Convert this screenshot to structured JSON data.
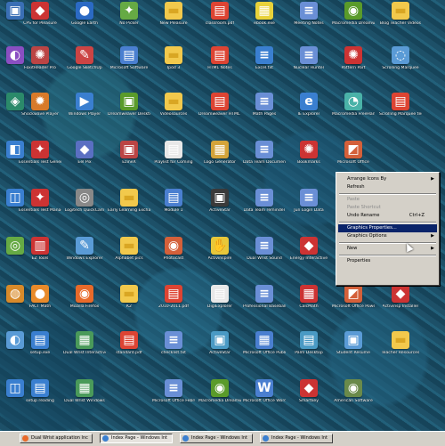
{
  "desktop": {
    "icons": [
      {
        "label": "",
        "icon": "app-icon",
        "color": "#3a6fb5",
        "glyph": "▣",
        "col": 0,
        "row": 0
      },
      {
        "label": "CPS for Pleasure",
        "icon": "app-icon",
        "color": "#c33",
        "glyph": "◆",
        "col": 1,
        "row": 0
      },
      {
        "label": "Google Earth",
        "icon": "globe-icon",
        "color": "#2b6ac4",
        "glyph": "●",
        "col": 2,
        "row": 0
      },
      {
        "label": "No Picker",
        "icon": "app-icon",
        "color": "#6a4",
        "glyph": "✦",
        "col": 3,
        "row": 0
      },
      {
        "label": "New Pleasure",
        "icon": "folder-icon",
        "color": "#f2c94c",
        "glyph": "▬",
        "col": 4,
        "row": 0
      },
      {
        "label": "classroom.pdf",
        "icon": "pdf-icon",
        "color": "#d43",
        "glyph": "▤",
        "col": 5,
        "row": 0
      },
      {
        "label": "ebook.exe",
        "icon": "app-icon",
        "color": "#e8d23a",
        "glyph": "▦",
        "col": 6,
        "row": 0
      },
      {
        "label": "Meeting Notes",
        "icon": "document-icon",
        "color": "#6a8fd6",
        "glyph": "≡",
        "col": 7,
        "row": 0
      },
      {
        "label": "Macromedia Dreamweaver",
        "icon": "dreamweaver-icon",
        "color": "#5a9b2a",
        "glyph": "◉",
        "col": 8,
        "row": 0
      },
      {
        "label": "Blog Teacher Videos",
        "icon": "folder-icon",
        "color": "#f2c94c",
        "glyph": "▬",
        "col": 9,
        "row": 0
      },
      {
        "label": "",
        "icon": "app-icon",
        "color": "#8a4fc2",
        "glyph": "◐",
        "col": 0,
        "row": 1
      },
      {
        "label": "FoxitReader Pro",
        "icon": "app-icon",
        "color": "#b44",
        "glyph": "✺",
        "col": 1,
        "row": 1
      },
      {
        "label": "Google SketchUp",
        "icon": "app-icon",
        "color": "#c44",
        "glyph": "✎",
        "col": 2,
        "row": 1
      },
      {
        "label": "Microsoft Software",
        "icon": "document-icon",
        "color": "#4a7fd0",
        "glyph": "▤",
        "col": 3,
        "row": 1
      },
      {
        "label": "Ipod 3",
        "icon": "folder-icon",
        "color": "#f2c94c",
        "glyph": "▬",
        "col": 4,
        "row": 1
      },
      {
        "label": "HTML Notes",
        "icon": "pdf-icon",
        "color": "#d43",
        "glyph": "▤",
        "col": 5,
        "row": 1
      },
      {
        "label": "Excel.txt",
        "icon": "document-icon",
        "color": "#3a7fd0",
        "glyph": "≡",
        "col": 6,
        "row": 1
      },
      {
        "label": "Nuclear Hunter",
        "icon": "document-icon",
        "color": "#6a8fd6",
        "glyph": "≡",
        "col": 7,
        "row": 1
      },
      {
        "label": "Pattern Part",
        "icon": "app-icon",
        "color": "#c33",
        "glyph": "✺",
        "col": 8,
        "row": 1
      },
      {
        "label": "Scrolling Marquee",
        "icon": "app-icon",
        "color": "#5a9bd6",
        "glyph": "◌",
        "col": 9,
        "row": 1
      },
      {
        "label": "",
        "icon": "app-icon",
        "color": "#2b8a6a",
        "glyph": "◈",
        "col": 0,
        "row": 2
      },
      {
        "label": "Shockwave Player",
        "icon": "app-icon",
        "color": "#d87a2a",
        "glyph": "✹",
        "col": 1,
        "row": 2
      },
      {
        "label": "Windows Player",
        "icon": "app-icon",
        "color": "#3a7fd0",
        "glyph": "▶",
        "col": 2,
        "row": 2
      },
      {
        "label": "Dreamweaver Desktop",
        "icon": "app-icon",
        "color": "#5a9b2a",
        "glyph": "▣",
        "col": 3,
        "row": 2
      },
      {
        "label": "Videosources",
        "icon": "folder-icon",
        "color": "#f2c94c",
        "glyph": "▬",
        "col": 4,
        "row": 2
      },
      {
        "label": "Dreamweaver HTML Code",
        "icon": "pdf-icon",
        "color": "#d43",
        "glyph": "▤",
        "col": 5,
        "row": 2
      },
      {
        "label": "Math Pages",
        "icon": "document-icon",
        "color": "#6a8fd6",
        "glyph": "≡",
        "col": 6,
        "row": 2
      },
      {
        "label": "IE Explorer",
        "icon": "ie-icon",
        "color": "#3a7fd0",
        "glyph": "e",
        "col": 7,
        "row": 2
      },
      {
        "label": "Macromedia FreeHand",
        "icon": "app-icon",
        "color": "#4ab2a8",
        "glyph": "◔",
        "col": 8,
        "row": 2
      },
      {
        "label": "Scrolling Marquee test",
        "icon": "pdf-icon",
        "color": "#d43",
        "glyph": "▤",
        "col": 9,
        "row": 2
      },
      {
        "label": "",
        "icon": "app-icon",
        "color": "#3a7fd0",
        "glyph": "◧",
        "col": 0,
        "row": 3
      },
      {
        "label": "Essentials Test Generator",
        "icon": "app-icon",
        "color": "#c33",
        "glyph": "✦",
        "col": 1,
        "row": 3
      },
      {
        "label": "Eel Pix",
        "icon": "app-icon",
        "color": "#5a6fc2",
        "glyph": "◆",
        "col": 2,
        "row": 3
      },
      {
        "label": "EzineX",
        "icon": "app-icon",
        "color": "#b44",
        "glyph": "▣",
        "col": 3,
        "row": 3
      },
      {
        "label": "Playlist for Coming",
        "icon": "document-icon",
        "color": "#e8e8e8",
        "glyph": "▤",
        "col": 4,
        "row": 3
      },
      {
        "label": "Logo Generator",
        "icon": "app-icon",
        "color": "#d4a43a",
        "glyph": "▦",
        "col": 5,
        "row": 3
      },
      {
        "label": "Data Team Documents",
        "icon": "document-icon",
        "color": "#6a8fd6",
        "glyph": "≡",
        "col": 6,
        "row": 3
      },
      {
        "label": "Bookmarks",
        "icon": "app-icon",
        "color": "#c33",
        "glyph": "✺",
        "col": 7,
        "row": 3
      },
      {
        "label": "Microsoft Office",
        "icon": "app-icon",
        "color": "#d4603a",
        "glyph": "◩",
        "col": 8,
        "row": 3
      },
      {
        "label": "",
        "icon": "",
        "color": "",
        "glyph": "",
        "col": 9,
        "row": 3
      },
      {
        "label": "",
        "icon": "app-icon",
        "color": "#3a7fd0",
        "glyph": "◫",
        "col": 0,
        "row": 4
      },
      {
        "label": "Essentials Test Manager",
        "icon": "app-icon",
        "color": "#c33",
        "glyph": "✦",
        "col": 1,
        "row": 4
      },
      {
        "label": "Logitech QuickCam",
        "icon": "camera-icon",
        "color": "#888",
        "glyph": "◎",
        "col": 2,
        "row": 4
      },
      {
        "label": "Early Learning Exchange",
        "icon": "folder-icon",
        "color": "#f2c94c",
        "glyph": "▬",
        "col": 3,
        "row": 4
      },
      {
        "label": "Module 1",
        "icon": "app-icon",
        "color": "#4a7fd0",
        "glyph": "▤",
        "col": 4,
        "row": 4
      },
      {
        "label": "ActiveStar",
        "icon": "app-icon",
        "color": "#3a3a3a",
        "glyph": "▣",
        "col": 5,
        "row": 4
      },
      {
        "label": "Data Team reminder",
        "icon": "document-icon",
        "color": "#6a8fd6",
        "glyph": "≡",
        "col": 6,
        "row": 4
      },
      {
        "label": "Jun Login Data",
        "icon": "document-icon",
        "color": "#6a8fd6",
        "glyph": "≡",
        "col": 7,
        "row": 4
      },
      {
        "label": "",
        "icon": "",
        "color": "",
        "glyph": "",
        "col": 8,
        "row": 4
      },
      {
        "label": "",
        "icon": "",
        "color": "",
        "glyph": "",
        "col": 9,
        "row": 4
      },
      {
        "label": "",
        "icon": "app-icon",
        "color": "#6a4",
        "glyph": "◎",
        "col": 0,
        "row": 5
      },
      {
        "label": "EZ Tools",
        "icon": "app-icon",
        "color": "#c33",
        "glyph": "▥",
        "col": 1,
        "row": 5
      },
      {
        "label": "Windows Explorer",
        "icon": "app-icon",
        "color": "#5a9bd6",
        "glyph": "✎",
        "col": 2,
        "row": 5
      },
      {
        "label": "Alphabet pics",
        "icon": "folder-icon",
        "color": "#f2c94c",
        "glyph": "▬",
        "col": 3,
        "row": 5
      },
      {
        "label": "Photocast",
        "icon": "app-icon",
        "color": "#d4603a",
        "glyph": "◉",
        "col": 4,
        "row": 5
      },
      {
        "label": "Activinspire",
        "icon": "app-icon",
        "color": "#e8c83a",
        "glyph": "✋",
        "col": 5,
        "row": 5
      },
      {
        "label": "Dual Wrist Sound",
        "icon": "document-icon",
        "color": "#6a8fd6",
        "glyph": "≡",
        "col": 6,
        "row": 5
      },
      {
        "label": "Energy Interactive",
        "icon": "app-icon",
        "color": "#c33",
        "glyph": "◆",
        "col": 7,
        "row": 5
      },
      {
        "label": "",
        "icon": "",
        "color": "",
        "glyph": "",
        "col": 8,
        "row": 5
      },
      {
        "label": "",
        "icon": "",
        "color": "",
        "glyph": "",
        "col": 9,
        "row": 5
      },
      {
        "label": "",
        "icon": "app-icon",
        "color": "#d88a2a",
        "glyph": "◍",
        "col": 0,
        "row": 6
      },
      {
        "label": "FACT Math",
        "icon": "app-icon",
        "color": "#e88a2a",
        "glyph": "●",
        "col": 1,
        "row": 6
      },
      {
        "label": "Mozilla Firefox",
        "icon": "firefox-icon",
        "color": "#e86a2a",
        "glyph": "◉",
        "col": 2,
        "row": 6
      },
      {
        "label": "K2",
        "icon": "folder-icon",
        "color": "#f2c94c",
        "glyph": "▬",
        "col": 3,
        "row": 6
      },
      {
        "label": "2010-2011.pdf",
        "icon": "pdf-icon",
        "color": "#d43",
        "glyph": "▤",
        "col": 4,
        "row": 6
      },
      {
        "label": "DigiExplorer",
        "icon": "document-icon",
        "color": "#e8e8e8",
        "glyph": "▤",
        "col": 5,
        "row": 6
      },
      {
        "label": "Professional Baseball",
        "icon": "document-icon",
        "color": "#6a8fd6",
        "glyph": "≡",
        "col": 6,
        "row": 6
      },
      {
        "label": "CalcMath",
        "icon": "app-icon",
        "color": "#c33",
        "glyph": "▦",
        "col": 7,
        "row": 6
      },
      {
        "label": "Microsoft Office PowerPoint",
        "icon": "app-icon",
        "color": "#d4603a",
        "glyph": "◩",
        "col": 8,
        "row": 6
      },
      {
        "label": "Activinsp Installer",
        "icon": "app-icon",
        "color": "#c33",
        "glyph": "◆",
        "col": 9,
        "row": 6
      },
      {
        "label": "",
        "icon": "app-icon",
        "color": "#5a9bd6",
        "glyph": "◐",
        "col": 0,
        "row": 7
      },
      {
        "label": "setup.exe",
        "icon": "app-icon",
        "color": "#3a7fd0",
        "glyph": "▤",
        "col": 1,
        "row": 7
      },
      {
        "label": "Dual Wrist Interactive",
        "icon": "app-icon",
        "color": "#4a9a5a",
        "glyph": "▦",
        "col": 2,
        "row": 7
      },
      {
        "label": "standard.pdf",
        "icon": "pdf-icon",
        "color": "#d43",
        "glyph": "▤",
        "col": 3,
        "row": 7
      },
      {
        "label": "checklist.txt",
        "icon": "document-icon",
        "color": "#6a8fd6",
        "glyph": "≡",
        "col": 4,
        "row": 7
      },
      {
        "label": "ActiveStar",
        "icon": "app-icon",
        "color": "#4a9ac4",
        "glyph": "▣",
        "col": 5,
        "row": 7
      },
      {
        "label": "Microsoft Office Publisher 2003",
        "icon": "app-icon",
        "color": "#4a7fd0",
        "glyph": "▦",
        "col": 6,
        "row": 7
      },
      {
        "label": "Palm Desktop",
        "icon": "app-icon",
        "color": "#4a9ac4",
        "glyph": "▤",
        "col": 7,
        "row": 7
      },
      {
        "label": "Student Resume",
        "icon": "app-icon",
        "color": "#5a9bd6",
        "glyph": "▣",
        "col": 8,
        "row": 7
      },
      {
        "label": "Teacher Resources",
        "icon": "folder-icon",
        "color": "#f2c94c",
        "glyph": "▬",
        "col": 9,
        "row": 7
      },
      {
        "label": "",
        "icon": "app-icon",
        "color": "#3a7fd0",
        "glyph": "◫",
        "col": 0,
        "row": 8
      },
      {
        "label": "setup reading",
        "icon": "app-icon",
        "color": "#3a7fd0",
        "glyph": "▤",
        "col": 1,
        "row": 8
      },
      {
        "label": "Dual Wrist Windows",
        "icon": "app-icon",
        "color": "#4a9a5a",
        "glyph": "▦",
        "col": 2,
        "row": 8
      },
      {
        "label": "",
        "icon": "",
        "color": "",
        "glyph": "",
        "col": 3,
        "row": 8
      },
      {
        "label": "Microsoft Office February",
        "icon": "document-icon",
        "color": "#6a8fd6",
        "glyph": "≡",
        "col": 4,
        "row": 8
      },
      {
        "label": "Macromedia Dreamweaver",
        "icon": "dreamweaver-icon",
        "color": "#5a9b2a",
        "glyph": "◉",
        "col": 5,
        "row": 8
      },
      {
        "label": "Microsoft Office Word 2003",
        "icon": "app-icon",
        "color": "#4a7fd0",
        "glyph": "W",
        "col": 6,
        "row": 8
      },
      {
        "label": "Smartkey",
        "icon": "app-icon",
        "color": "#c33",
        "glyph": "◆",
        "col": 7,
        "row": 8
      },
      {
        "label": "American Software",
        "icon": "app-icon",
        "color": "#6a8a4a",
        "glyph": "◉",
        "col": 8,
        "row": 8
      },
      {
        "label": "",
        "icon": "",
        "color": "",
        "glyph": "",
        "col": 9,
        "row": 8
      }
    ]
  },
  "context_menu": {
    "items": [
      {
        "label": "Arrange Icons By",
        "submenu": true,
        "state": "normal"
      },
      {
        "label": "Refresh",
        "submenu": false,
        "state": "normal"
      },
      {
        "separator": true
      },
      {
        "label": "Paste",
        "submenu": false,
        "state": "disabled"
      },
      {
        "label": "Paste Shortcut",
        "submenu": false,
        "state": "disabled"
      },
      {
        "label": "Undo Rename",
        "shortcut": "Ctrl+Z",
        "submenu": false,
        "state": "normal"
      },
      {
        "separator": true
      },
      {
        "label": "Graphics Properties...",
        "submenu": false,
        "state": "highlight"
      },
      {
        "label": "Graphics Options",
        "submenu": true,
        "state": "normal"
      },
      {
        "separator": true
      },
      {
        "label": "New",
        "submenu": true,
        "state": "normal"
      },
      {
        "separator": true
      },
      {
        "label": "Properties",
        "submenu": false,
        "state": "normal"
      }
    ]
  },
  "taskbar": {
    "buttons": [
      {
        "label": "Dual Wrist application lnc",
        "icon": "firefox-icon",
        "color": "#e86a2a",
        "active": false
      },
      {
        "label": "Index Page - Windows Int",
        "icon": "ie-icon",
        "color": "#3a7fd0",
        "active": true
      },
      {
        "label": "Index Page - Windows Int",
        "icon": "ie-icon",
        "color": "#3a7fd0",
        "active": false
      },
      {
        "label": "Index Page - Windows Int",
        "icon": "ie-icon",
        "color": "#3a7fd0",
        "active": false
      }
    ]
  },
  "colors": {
    "desktop": "#1a4d66",
    "menu_bg": "#d4d0c8",
    "highlight": "#0a246a",
    "selected_label": "#2d5f9e"
  }
}
